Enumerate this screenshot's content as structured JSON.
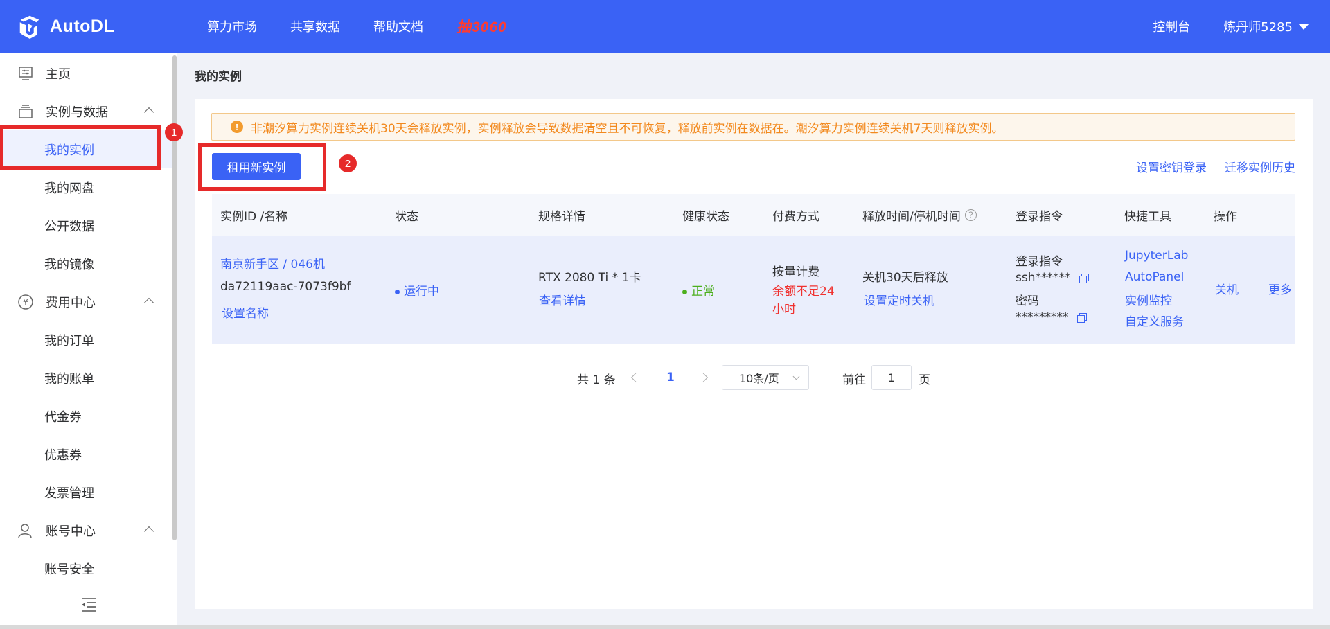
{
  "topbar": {
    "brand": "AutoDL",
    "nav": [
      "算力市场",
      "共享数据",
      "帮助文档"
    ],
    "promo": "抽3060",
    "console": "控制台",
    "user": "炼丹师5285"
  },
  "sidebar": {
    "home": "主页",
    "instances_group": "实例与数据",
    "my_instances": "我的实例",
    "my_disk": "我的网盘",
    "public_data": "公开数据",
    "my_images": "我的镜像",
    "billing_group": "费用中心",
    "my_orders": "我的订单",
    "my_bills": "我的账单",
    "vouchers": "代金券",
    "coupons": "优惠券",
    "invoices": "发票管理",
    "account_group": "账号中心",
    "account_security": "账号安全"
  },
  "annotations": {
    "badge1": "1",
    "badge2": "2"
  },
  "main": {
    "title": "我的实例",
    "alert": "非潮汐算力实例连续关机30天会释放实例，实例释放会导致数据清空且不可恢复，释放前实例在数据在。潮汐算力实例连续关机7天则释放实例。",
    "rent_button": "租用新实例",
    "link_ssh_key": "设置密钥登录",
    "link_migrate": "迁移实例历史"
  },
  "table": {
    "headers": [
      "实例ID /名称",
      "状态",
      "规格详情",
      "健康状态",
      "付费方式",
      "释放时间/停机时间",
      "登录指令",
      "快捷工具",
      "操作"
    ],
    "row": {
      "name": "南京新手区 / 046机",
      "id": "da72119aac-7073f9bf",
      "set_name": "设置名称",
      "status": "运行中",
      "spec": "RTX 2080 Ti * 1卡",
      "view_details": "查看详情",
      "health": "正常",
      "billing": "按量计费",
      "balance_warn_1": "余额不足24",
      "balance_warn_2": "小时",
      "release": "关机30天后释放",
      "set_shutdown": "设置定时关机",
      "login_label": "登录指令",
      "ssh_cmd": "ssh******",
      "password_label": "密码",
      "password": "*********",
      "tools": [
        "JupyterLab",
        "AutoPanel",
        "实例监控",
        "自定义服务"
      ],
      "shutdown": "关机",
      "more": "更多"
    }
  },
  "pagination": {
    "total": "共 1 条",
    "current": "1",
    "page_size": "10条/页",
    "goto_label": "前往",
    "goto_value": "1",
    "page_suffix": "页"
  },
  "colors": {
    "primary": "#3a62f5",
    "warning": "#f2891e",
    "danger": "#f0312f",
    "success": "#4caf1e",
    "annotation": "#e62a2a"
  }
}
